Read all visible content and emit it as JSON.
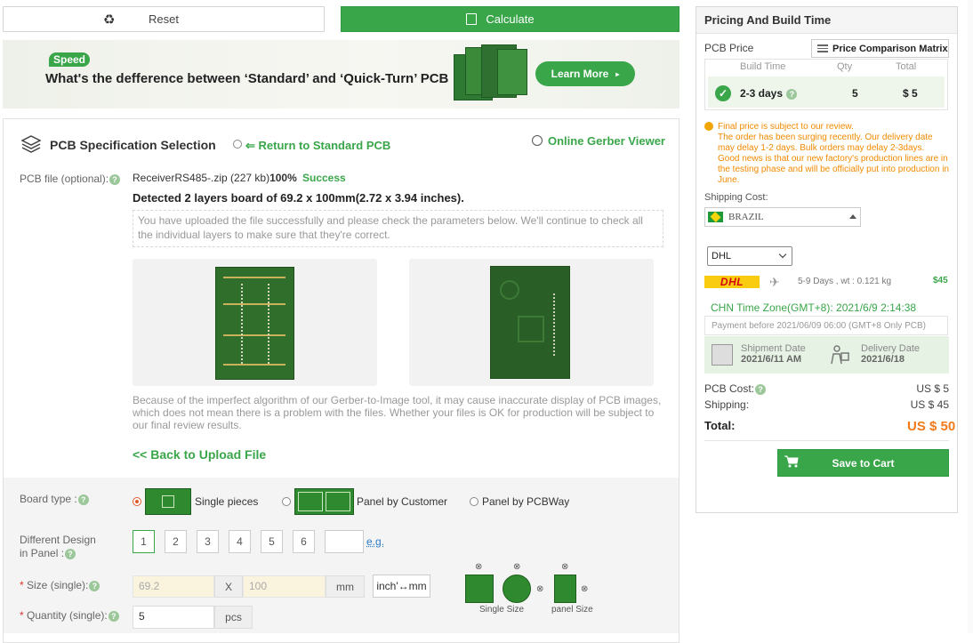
{
  "toolbar": {
    "reset_label": "Reset",
    "calculate_label": "Calculate"
  },
  "banner": {
    "tag": "Speed",
    "headline": "What's the defference between ‘Standard’ and ‘Quick-Turn’ PCB",
    "button": "Learn More"
  },
  "spec": {
    "title": "PCB Specification Selection",
    "return_link": "⇐ Return to Standard PCB",
    "viewer_link": "Online Gerber Viewer",
    "file_label": "PCB file (optional):",
    "file_name": "ReceiverRS485-.zip (227 kb)",
    "file_percent": "100%",
    "file_status": "Success",
    "detected": "Detected 2 layers board of 69.2 x 100mm(2.72 x 3.94 inches).",
    "upload_note": "You have uploaded the file successfully and please check the parameters below. We'll continue to check all the individual layers to make sure that they're correct.",
    "algo_note": "Because of the imperfect algorithm of our Gerber-to-Image tool, it may cause inaccurate display of PCB images, which does not mean there is a problem with the files. Whether your files is OK for production will be subject to our final review results.",
    "back_link": "<< Back to Upload File"
  },
  "form": {
    "board_type_label": "Board type :",
    "board_options": [
      "Single pieces",
      "Panel by Customer",
      "Panel by PCBWay"
    ],
    "diff_design_label_1": "Different Design",
    "diff_design_label_2": "in Panel :",
    "design_numbers": [
      "1",
      "2",
      "3",
      "4",
      "5",
      "6"
    ],
    "eg_link": "e.g.",
    "size_label": "Size (single):",
    "size_x_placeholder": "69.2",
    "size_sep": "X",
    "size_y_placeholder": "100",
    "size_unit": "mm",
    "unit_toggle": "inch'↔mm",
    "qty_label": "Quantity (single):",
    "qty_value": "5",
    "qty_unit": "pcs",
    "single_size_caption": "Single Size",
    "panel_size_caption": "panel Size",
    "required_mark": "*"
  },
  "pricing": {
    "title": "Pricing And Build Time",
    "pcb_price_label": "PCB Price",
    "matrix_button": "Price Comparison Matrix",
    "headers": [
      "Build Time",
      "Qty",
      "Total"
    ],
    "row": {
      "build_time": "2-3 days",
      "qty": "5",
      "total": "$ 5"
    },
    "notice_lines": [
      "Final price is subject to our review.",
      "The order has been surging recently. Our delivery date may delay 1-2 days. Bulk orders may delay 2-3days.",
      "Good news is that our new factory's production lines are in the testing phase and will be officially put into production in June."
    ],
    "shipping_cost_label": "Shipping Cost:",
    "country": "BRAZIL",
    "carrier": "DHL",
    "carrier_logo": "DHL",
    "ship_days": "5-9 Days ,  wt : 0.121 kg",
    "ship_price": "$45",
    "time_zone": "CHN Time Zone(GMT+8): 2021/6/9 2:14:38",
    "pay_before": "Payment before 2021/06/09 06:00 (GMT+8 Only PCB)",
    "shipment_date_label": "Shipment Date",
    "shipment_date": "2021/6/11 AM",
    "delivery_date_label": "Delivery Date",
    "delivery_date": "2021/6/18",
    "pcb_cost_label": "PCB Cost:",
    "pcb_cost": "US $ 5",
    "shipping_label": "Shipping:",
    "shipping": "US $ 45",
    "total_label": "Total:",
    "total": "US $ 50",
    "save_cart": "Save to Cart"
  },
  "colors": {
    "accent_green": "#3aa64a",
    "warning_orange": "#f08a00",
    "total_orange": "#f07a1a"
  }
}
